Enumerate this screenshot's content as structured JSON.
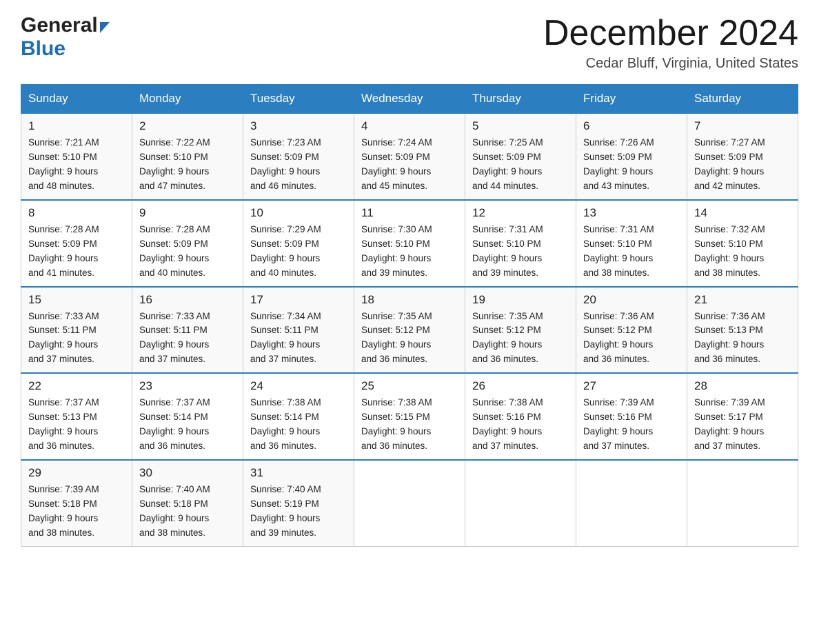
{
  "header": {
    "logo_general": "General",
    "logo_blue": "Blue",
    "month_title": "December 2024",
    "location": "Cedar Bluff, Virginia, United States"
  },
  "days_of_week": [
    "Sunday",
    "Monday",
    "Tuesday",
    "Wednesday",
    "Thursday",
    "Friday",
    "Saturday"
  ],
  "weeks": [
    [
      {
        "day": "1",
        "sunrise": "7:21 AM",
        "sunset": "5:10 PM",
        "daylight": "9 hours and 48 minutes."
      },
      {
        "day": "2",
        "sunrise": "7:22 AM",
        "sunset": "5:10 PM",
        "daylight": "9 hours and 47 minutes."
      },
      {
        "day": "3",
        "sunrise": "7:23 AM",
        "sunset": "5:09 PM",
        "daylight": "9 hours and 46 minutes."
      },
      {
        "day": "4",
        "sunrise": "7:24 AM",
        "sunset": "5:09 PM",
        "daylight": "9 hours and 45 minutes."
      },
      {
        "day": "5",
        "sunrise": "7:25 AM",
        "sunset": "5:09 PM",
        "daylight": "9 hours and 44 minutes."
      },
      {
        "day": "6",
        "sunrise": "7:26 AM",
        "sunset": "5:09 PM",
        "daylight": "9 hours and 43 minutes."
      },
      {
        "day": "7",
        "sunrise": "7:27 AM",
        "sunset": "5:09 PM",
        "daylight": "9 hours and 42 minutes."
      }
    ],
    [
      {
        "day": "8",
        "sunrise": "7:28 AM",
        "sunset": "5:09 PM",
        "daylight": "9 hours and 41 minutes."
      },
      {
        "day": "9",
        "sunrise": "7:28 AM",
        "sunset": "5:09 PM",
        "daylight": "9 hours and 40 minutes."
      },
      {
        "day": "10",
        "sunrise": "7:29 AM",
        "sunset": "5:09 PM",
        "daylight": "9 hours and 40 minutes."
      },
      {
        "day": "11",
        "sunrise": "7:30 AM",
        "sunset": "5:10 PM",
        "daylight": "9 hours and 39 minutes."
      },
      {
        "day": "12",
        "sunrise": "7:31 AM",
        "sunset": "5:10 PM",
        "daylight": "9 hours and 39 minutes."
      },
      {
        "day": "13",
        "sunrise": "7:31 AM",
        "sunset": "5:10 PM",
        "daylight": "9 hours and 38 minutes."
      },
      {
        "day": "14",
        "sunrise": "7:32 AM",
        "sunset": "5:10 PM",
        "daylight": "9 hours and 38 minutes."
      }
    ],
    [
      {
        "day": "15",
        "sunrise": "7:33 AM",
        "sunset": "5:11 PM",
        "daylight": "9 hours and 37 minutes."
      },
      {
        "day": "16",
        "sunrise": "7:33 AM",
        "sunset": "5:11 PM",
        "daylight": "9 hours and 37 minutes."
      },
      {
        "day": "17",
        "sunrise": "7:34 AM",
        "sunset": "5:11 PM",
        "daylight": "9 hours and 37 minutes."
      },
      {
        "day": "18",
        "sunrise": "7:35 AM",
        "sunset": "5:12 PM",
        "daylight": "9 hours and 36 minutes."
      },
      {
        "day": "19",
        "sunrise": "7:35 AM",
        "sunset": "5:12 PM",
        "daylight": "9 hours and 36 minutes."
      },
      {
        "day": "20",
        "sunrise": "7:36 AM",
        "sunset": "5:12 PM",
        "daylight": "9 hours and 36 minutes."
      },
      {
        "day": "21",
        "sunrise": "7:36 AM",
        "sunset": "5:13 PM",
        "daylight": "9 hours and 36 minutes."
      }
    ],
    [
      {
        "day": "22",
        "sunrise": "7:37 AM",
        "sunset": "5:13 PM",
        "daylight": "9 hours and 36 minutes."
      },
      {
        "day": "23",
        "sunrise": "7:37 AM",
        "sunset": "5:14 PM",
        "daylight": "9 hours and 36 minutes."
      },
      {
        "day": "24",
        "sunrise": "7:38 AM",
        "sunset": "5:14 PM",
        "daylight": "9 hours and 36 minutes."
      },
      {
        "day": "25",
        "sunrise": "7:38 AM",
        "sunset": "5:15 PM",
        "daylight": "9 hours and 36 minutes."
      },
      {
        "day": "26",
        "sunrise": "7:38 AM",
        "sunset": "5:16 PM",
        "daylight": "9 hours and 37 minutes."
      },
      {
        "day": "27",
        "sunrise": "7:39 AM",
        "sunset": "5:16 PM",
        "daylight": "9 hours and 37 minutes."
      },
      {
        "day": "28",
        "sunrise": "7:39 AM",
        "sunset": "5:17 PM",
        "daylight": "9 hours and 37 minutes."
      }
    ],
    [
      {
        "day": "29",
        "sunrise": "7:39 AM",
        "sunset": "5:18 PM",
        "daylight": "9 hours and 38 minutes."
      },
      {
        "day": "30",
        "sunrise": "7:40 AM",
        "sunset": "5:18 PM",
        "daylight": "9 hours and 38 minutes."
      },
      {
        "day": "31",
        "sunrise": "7:40 AM",
        "sunset": "5:19 PM",
        "daylight": "9 hours and 39 minutes."
      },
      null,
      null,
      null,
      null
    ]
  ],
  "labels": {
    "sunrise": "Sunrise:",
    "sunset": "Sunset:",
    "daylight": "Daylight:"
  }
}
